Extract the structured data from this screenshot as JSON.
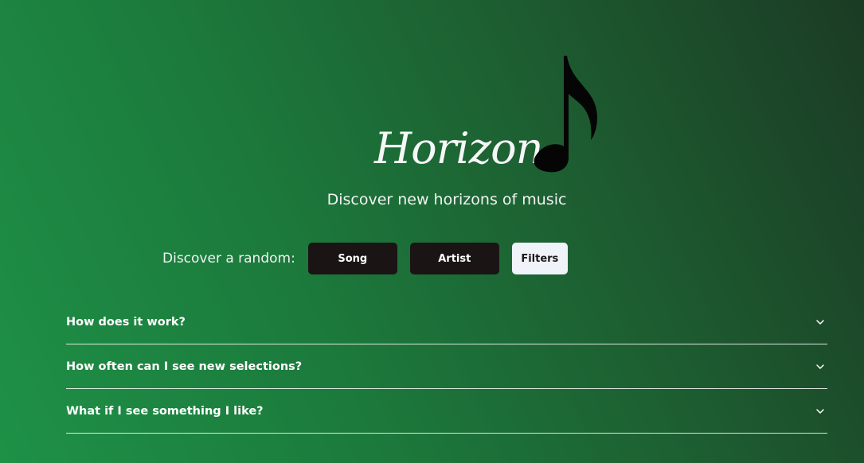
{
  "hero": {
    "title": "Horizon",
    "subtitle": "Discover new horizons of music",
    "note_icon": "music-note-icon"
  },
  "discover": {
    "label": "Discover a random:",
    "buttons": [
      {
        "label": "Song"
      },
      {
        "label": "Artist"
      },
      {
        "label": "Filters"
      }
    ]
  },
  "faq": {
    "items": [
      {
        "question": "How does it work?",
        "icon": "chevron-down-icon"
      },
      {
        "question": "How often can I see new selections?",
        "icon": "chevron-down-icon"
      },
      {
        "question": "What if I see something I like?",
        "icon": "chevron-down-icon"
      }
    ]
  },
  "colors": {
    "gradient_start": "#1e9147",
    "gradient_end": "#1b3b24",
    "button_dark": "#1a1414",
    "button_light": "#f0f3f9"
  }
}
